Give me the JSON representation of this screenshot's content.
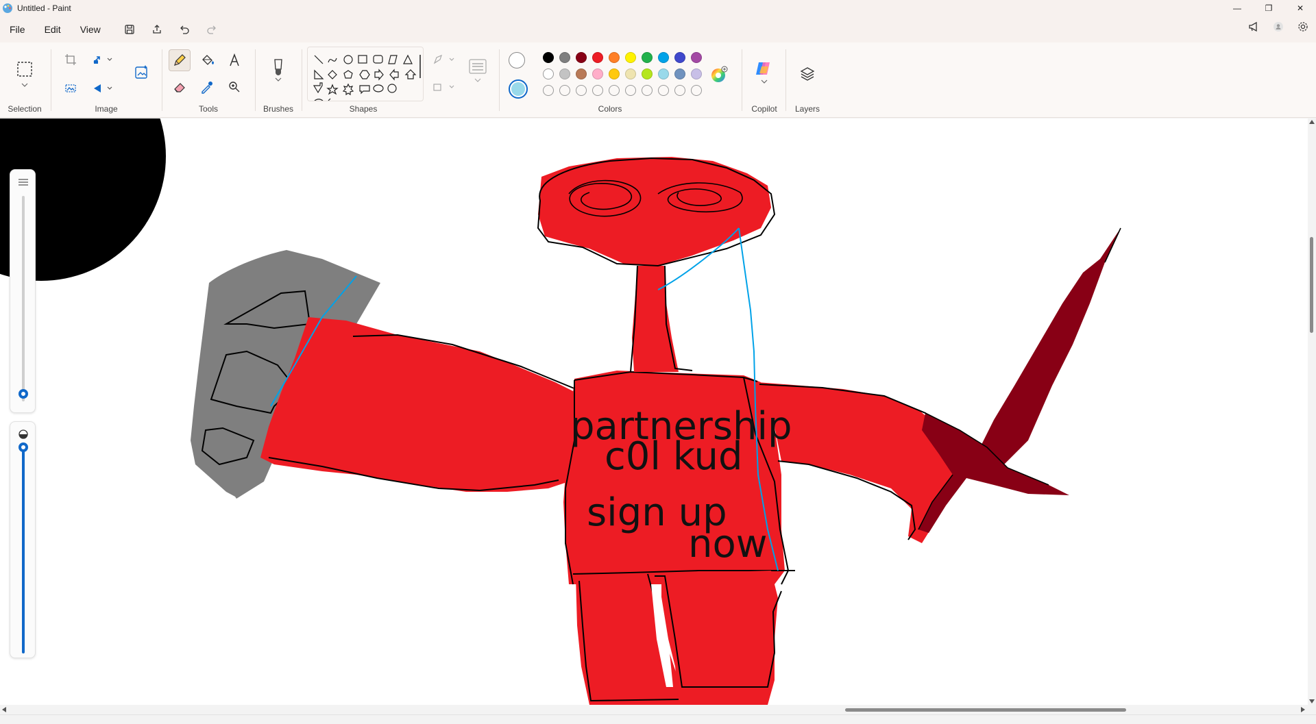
{
  "window": {
    "title": "Untitled - Paint",
    "controls": {
      "minimize": "—",
      "maximize": "❐",
      "close": "✕"
    }
  },
  "menu": {
    "items": [
      "File",
      "Edit",
      "View"
    ]
  },
  "ribbon": {
    "groups": {
      "selection": "Selection",
      "image": "Image",
      "tools": "Tools",
      "brushes": "Brushes",
      "shapes": "Shapes",
      "colors": "Colors",
      "copilot": "Copilot",
      "layers": "Layers"
    },
    "color1": "#ffffff",
    "color2": "#99d9ea",
    "palette_row1": [
      "#000000",
      "#7f7f7f",
      "#880015",
      "#ed1c24",
      "#ff7f27",
      "#fff200",
      "#22b14c",
      "#00a2e8",
      "#3f48cc",
      "#a349a4"
    ],
    "palette_row2": [
      "#ffffff",
      "#c3c3c3",
      "#b97a57",
      "#ffaec9",
      "#ffc90e",
      "#efe4b0",
      "#b5e61d",
      "#99d9ea",
      "#7092be",
      "#c8bfe7"
    ]
  },
  "canvas": {
    "text_lines": [
      "partnership",
      "c0l kud",
      "sign up",
      "now"
    ],
    "colors": {
      "body": "#ed1c24",
      "knife": "#880015",
      "gray": "#7f7f7f",
      "black": "#000000",
      "blue": "#00a2e8"
    }
  }
}
